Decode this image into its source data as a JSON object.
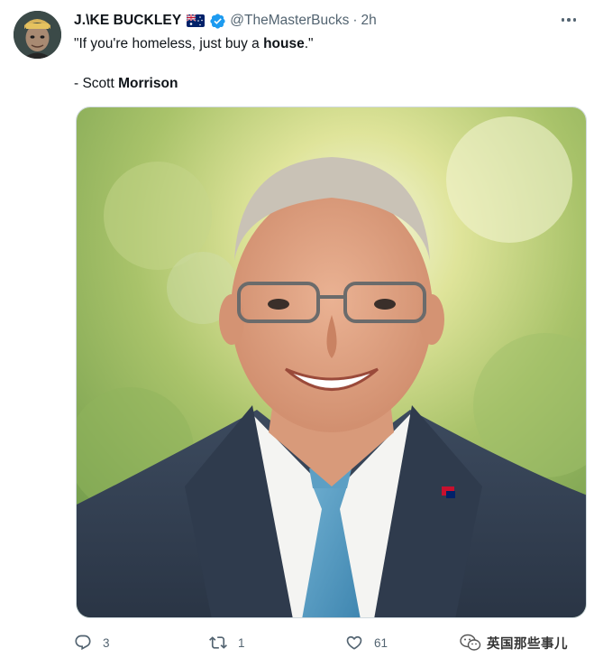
{
  "tweet": {
    "display_name": "J.\\KE BUCKLEY",
    "handle": "@TheMasterBucks",
    "separator": "·",
    "time": "2h",
    "text_line1_pre": "\"If you're homeless, just buy a ",
    "text_line1_bold": "house",
    "text_line1_post": ".\"",
    "text_line2_pre": "- Scott ",
    "text_line2_bold": "Morrison",
    "flag_icon": "australia-flag-icon",
    "verified_icon": "verified-badge-icon"
  },
  "actions": {
    "reply_count": "3",
    "retweet_count": "1",
    "like_count": "61"
  },
  "watermark": {
    "text": "英国那些事儿",
    "icon": "wechat-icon"
  },
  "colors": {
    "verified": "#1d9bf0",
    "secondary_text": "#536471",
    "primary_text": "#0f1419"
  }
}
